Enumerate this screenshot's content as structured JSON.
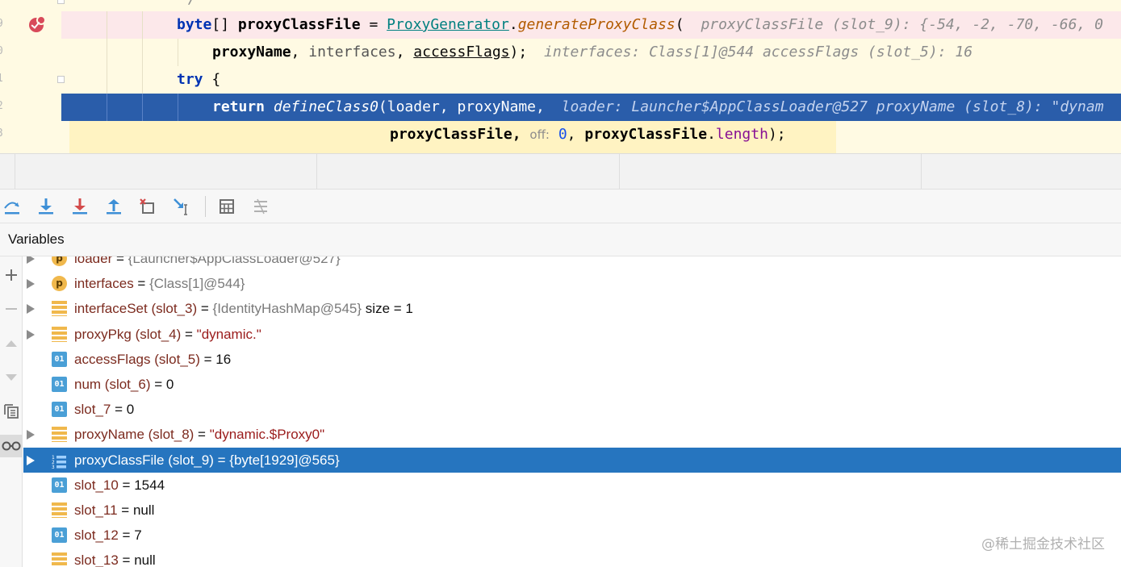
{
  "editor": {
    "comment_end": "*/",
    "line1": {
      "kw": "byte",
      "brackets": "[]",
      "var": "proxyClassFile",
      "eq": "=",
      "cls": "ProxyGenerator",
      "method": "generateProxyClass",
      "paren": "(",
      "hint": "proxyClassFile (slot_9): {-54, -2, -70, -66, 0"
    },
    "line2": {
      "arg1": "proxyName",
      "arg2": "interfaces",
      "arg3": "accessFlags",
      "close": ");",
      "hint": "interfaces: Class[1]@544  accessFlags (slot_5): 16"
    },
    "line3": {
      "kw": "try",
      "brace": "{"
    },
    "line4": {
      "kw": "return",
      "method": "defineClass0",
      "args": "(loader, proxyName,",
      "hint": "loader: Launcher$AppClassLoader@527  proxyName (slot_8): \"dynam"
    },
    "line5": {
      "arg1": "proxyClassFile,",
      "off_label": "off:",
      "off_val": "0",
      "arg2": "proxyClassFile",
      "dot": ".",
      "field": "length",
      "close": ");"
    }
  },
  "toolbar": {
    "buttons": [
      {
        "name": "step-over-icon",
        "color": "#3d8fd6"
      },
      {
        "name": "step-into-icon",
        "color": "#3d8fd6"
      },
      {
        "name": "force-step-into-icon",
        "color": "#d34a4a"
      },
      {
        "name": "step-out-icon",
        "color": "#3d8fd6"
      },
      {
        "name": "drop-frame-icon",
        "color": "#d34a4a"
      },
      {
        "name": "run-to-cursor-icon",
        "color": "#3d8fd6"
      },
      {
        "name": "evaluate-expression-icon",
        "color": "#6e6e6e"
      },
      {
        "name": "trace-stream-icon",
        "color": "#a8a8a8"
      }
    ]
  },
  "variables": {
    "title": "Variables",
    "rows": [
      {
        "icon": "p",
        "expand": true,
        "name": "loader",
        "eq": " = ",
        "value": "{Launcher$AppClassLoader@527}",
        "vtype": "obj",
        "extra": ""
      },
      {
        "icon": "p",
        "expand": true,
        "name": "interfaces",
        "eq": " = ",
        "value": "{Class[1]@544}",
        "vtype": "obj",
        "extra": ""
      },
      {
        "icon": "list",
        "expand": true,
        "name": "interfaceSet (slot_3)",
        "eq": " = ",
        "value": "{IdentityHashMap@545}",
        "vtype": "obj",
        "extra": " size = 1"
      },
      {
        "icon": "list",
        "expand": true,
        "name": "proxyPkg (slot_4)",
        "eq": " = ",
        "value": "\"dynamic.\"",
        "vtype": "str",
        "extra": ""
      },
      {
        "icon": "01",
        "expand": false,
        "name": "accessFlags (slot_5)",
        "eq": " = ",
        "value": "16",
        "vtype": "num",
        "extra": ""
      },
      {
        "icon": "01",
        "expand": false,
        "name": "num (slot_6)",
        "eq": " = ",
        "value": "0",
        "vtype": "num",
        "extra": ""
      },
      {
        "icon": "01",
        "expand": false,
        "name": "slot_7",
        "eq": " = ",
        "value": "0",
        "vtype": "num",
        "extra": ""
      },
      {
        "icon": "list",
        "expand": true,
        "name": "proxyName (slot_8)",
        "eq": " = ",
        "value": "\"dynamic.$Proxy0\"",
        "vtype": "str",
        "extra": ""
      },
      {
        "icon": "arr",
        "expand": true,
        "name": "proxyClassFile (slot_9)",
        "eq": " = ",
        "value": "{byte[1929]@565}",
        "vtype": "obj",
        "extra": "",
        "selected": true
      },
      {
        "icon": "01",
        "expand": false,
        "name": "slot_10",
        "eq": " = ",
        "value": "1544",
        "vtype": "num",
        "extra": ""
      },
      {
        "icon": "list",
        "expand": false,
        "name": "slot_11",
        "eq": " = ",
        "value": "null",
        "vtype": "num",
        "extra": ""
      },
      {
        "icon": "01",
        "expand": false,
        "name": "slot_12",
        "eq": " = ",
        "value": "7",
        "vtype": "num",
        "extra": ""
      },
      {
        "icon": "list",
        "expand": false,
        "name": "slot_13",
        "eq": " = ",
        "value": "null",
        "vtype": "num",
        "extra": ""
      }
    ]
  },
  "sidebar": {
    "buttons": [
      {
        "name": "add-watch-icon",
        "glyph": "+"
      },
      {
        "name": "remove-watch-icon",
        "glyph": "−"
      },
      {
        "name": "move-up-icon",
        "glyph": "▲"
      },
      {
        "name": "move-down-icon",
        "glyph": "▼"
      },
      {
        "name": "copy-icon",
        "glyph": "❐"
      },
      {
        "name": "watches-icon",
        "glyph": "oo"
      }
    ]
  },
  "watermark": "@稀土掘金技术社区"
}
